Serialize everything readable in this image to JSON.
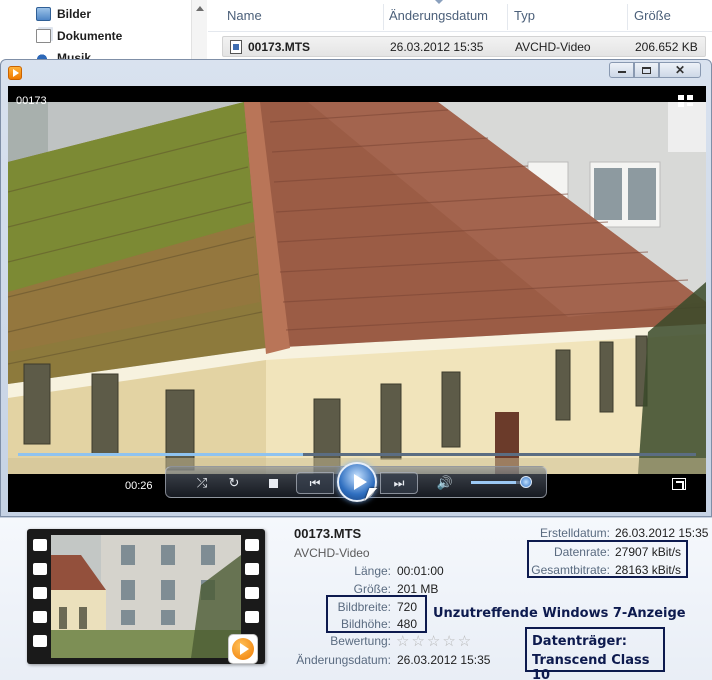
{
  "explorer": {
    "nav": [
      {
        "label": "Bilder",
        "icon": "pictures-icon"
      },
      {
        "label": "Dokumente",
        "icon": "documents-icon"
      },
      {
        "label": "Musik",
        "icon": "music-icon"
      }
    ],
    "columns": {
      "name": "Name",
      "date": "Änderungsdatum",
      "type": "Typ",
      "size": "Größe"
    },
    "file": {
      "name": "00173.MTS",
      "date": "26.03.2012 15:35",
      "type": "AVCHD-Video",
      "size": "206.652 KB"
    }
  },
  "player": {
    "video_title": "00173",
    "elapsed": "00:26",
    "progress": 0.42,
    "volume": 0.75,
    "colors": {
      "accent": "#2f6fc0",
      "seek": "#8fc3f0"
    }
  },
  "details": {
    "title": "00173.MTS",
    "subtitle": "AVCHD-Video",
    "props_left": [
      {
        "label": "Länge:",
        "value": "00:01:00"
      },
      {
        "label": "Größe:",
        "value": "201 MB"
      },
      {
        "label": "Bildbreite:",
        "value": "720"
      },
      {
        "label": "Bildhöhe:",
        "value": "480"
      },
      {
        "label": "Bewertung:",
        "value": "☆☆☆☆☆"
      },
      {
        "label": "Änderungsdatum:",
        "value": "26.03.2012 15:35"
      }
    ],
    "props_right": [
      {
        "label": "Erstelldatum:",
        "value": "26.03.2012 15:35"
      },
      {
        "label": "Datenrate:",
        "value": "27907 kBit/s"
      },
      {
        "label": "Gesamtbitrate:",
        "value": "28163 kBit/s"
      }
    ],
    "rating_stars": 0
  },
  "annotations": {
    "warning": "Unzutreffende Windows 7-Anzeige",
    "medium_line1": "Datenträger:",
    "medium_line2": "Transcend Class 10",
    "box_color": "#0d1a4e"
  }
}
